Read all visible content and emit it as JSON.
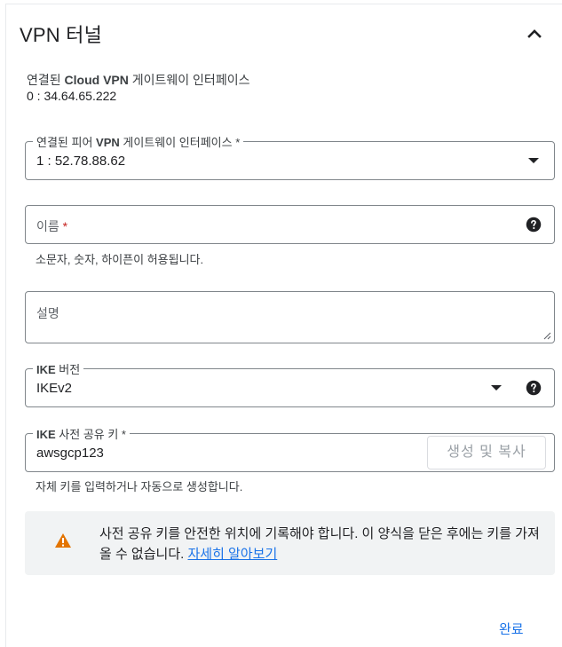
{
  "header": {
    "title": "VPN 터널"
  },
  "gateway": {
    "label_prefix": "연결된 ",
    "label_bold": "Cloud VPN",
    "label_suffix": " 게이트웨이 인터페이스",
    "value": "0 : 34.64.65.222"
  },
  "peer_gateway": {
    "legend_prefix": "연결된 피어 ",
    "legend_bold": "VPN",
    "legend_suffix": " 게이트웨이 인터페이스 *",
    "value": "1 : 52.78.88.62"
  },
  "name_field": {
    "placeholder": "이름",
    "required_mark": " *",
    "hint": "소문자, 숫자, 하이픈이 허용됩니다."
  },
  "description_field": {
    "placeholder": "설명"
  },
  "ike_version": {
    "legend_bold": "IKE",
    "legend_suffix": " 버전",
    "value": "IKEv2"
  },
  "ike_key": {
    "legend_bold": "IKE",
    "legend_suffix": " 사전 공유 키 *",
    "value": "awsgcp123",
    "generate_button": "생성 및 복사",
    "hint": "자체 키를 입력하거나 자동으로 생성합니다."
  },
  "warning": {
    "text": "사전 공유 키를 안전한 위치에 기록해야 합니다. 이 양식을 닫은 후에는 키를 가져올 수 없습니다. ",
    "link": "자세히 알아보기"
  },
  "footer": {
    "done_button": "완료"
  },
  "colors": {
    "accent": "#1a73e8",
    "warning_icon": "#e37400",
    "required": "#c5221f"
  },
  "icons": {
    "collapse": "chevron-up-icon",
    "dropdown": "dropdown-arrow-icon",
    "help": "help-icon",
    "warning": "warning-icon",
    "resize": "resize-handle-icon"
  }
}
